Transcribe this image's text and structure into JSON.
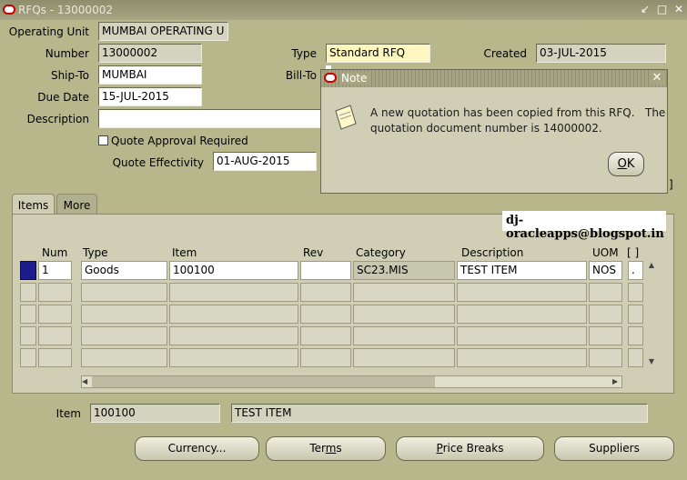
{
  "window": {
    "title": "RFQs - 13000002",
    "controls": "↙ □ ✕"
  },
  "header": {
    "operating_unit_label": "Operating Unit",
    "operating_unit": "MUMBAI OPERATING U",
    "number_label": "Number",
    "number": "13000002",
    "type_label": "Type",
    "type": "Standard RFQ",
    "created_label": "Created",
    "created": "03-JUL-2015",
    "ship_to_label": "Ship-To",
    "ship_to": "MUMBAI",
    "bill_to_label": "Bill-To",
    "due_date_label": "Due Date",
    "due_date": "15-JUL-2015",
    "description_label": "Description",
    "description": "",
    "quote_approval_label": "Quote Approval Required",
    "quote_effectivity_label": "Quote Effectivity",
    "quote_effectivity": "01-AUG-2015"
  },
  "tabs": [
    {
      "label": "Items"
    },
    {
      "label": "More"
    }
  ],
  "watermark": "dj-oracleapps@blogspot.in",
  "grid": {
    "columns": [
      "Num",
      "Type",
      "Item",
      "Rev",
      "Category",
      "Description",
      "UOM",
      "[ ]"
    ],
    "rows": [
      [
        "1",
        "Goods",
        "100100",
        "",
        "SC23.MIS",
        "TEST ITEM",
        "NOS",
        "."
      ]
    ]
  },
  "footer": {
    "item_label": "Item",
    "item": "100100",
    "item_desc": "TEST ITEM"
  },
  "buttons": {
    "currency": {
      "pre": "Currency",
      "post": ""
    },
    "terms": {
      "pre": "Ter",
      "u": "m",
      "post": "s"
    },
    "price_breaks": {
      "pre": "",
      "u": "P",
      "post": "rice Breaks"
    },
    "suppliers": {
      "pre": "Suppliers",
      "u": "",
      "post": ""
    },
    "currency_suffix": "..."
  },
  "dialog": {
    "title": "Note",
    "message_line1": "A new quotation has been copied from this RFQ.   The",
    "message_line2": "quotation document number is 14000002.",
    "ok_u": "O",
    "ok_post": "K"
  }
}
